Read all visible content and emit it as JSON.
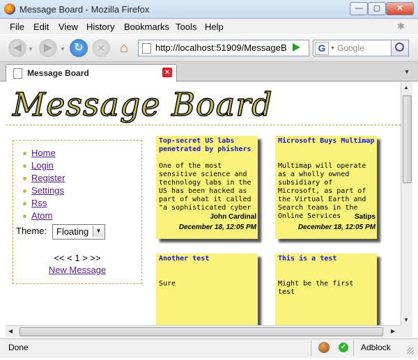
{
  "window": {
    "title": "Message Board - Mozilla Firefox",
    "controls": {
      "minimize": "—",
      "maximize": "▢",
      "close": "✕"
    }
  },
  "menu": [
    "File",
    "Edit",
    "View",
    "History",
    "Bookmarks",
    "Tools",
    "Help"
  ],
  "toolbar": {
    "url": "http://localhost:51909/MessageB",
    "search_placeholder": "Google",
    "search_engine_glyph": "G"
  },
  "tab": {
    "title": "Message Board"
  },
  "page": {
    "heading": "Message Board",
    "nav_links": [
      "Home",
      "Login",
      "Register",
      "Settings",
      "Rss",
      "Atom"
    ],
    "theme_label": "Theme:",
    "theme_value": "Floating",
    "pager": "<< < 1 > >>",
    "new_message": "New Message",
    "messages": [
      {
        "title": "Top-secret US labs penetrated by phishers",
        "body": "One of the most sensitive science and technology labs in the US has been hacked as part of what it called \"a sophisticated cyber",
        "author": "John Cardinal",
        "date": "December 18, 12:05 PM"
      },
      {
        "title": "Microsoft Buys Multimap",
        "body": "Multimap will operate as a wholly owned subsidiary of Microsoft, as part of the Virtual Earth and Search teams in the Online Services",
        "author": "Satips",
        "date": "December 18, 12:05 PM"
      },
      {
        "title": "Another test",
        "body": "Sure",
        "author": "",
        "date": ""
      },
      {
        "title": "This is a test",
        "body": "Might be the first test",
        "author": "",
        "date": ""
      }
    ]
  },
  "statusbar": {
    "text": "Done",
    "addon": "Adblock"
  }
}
